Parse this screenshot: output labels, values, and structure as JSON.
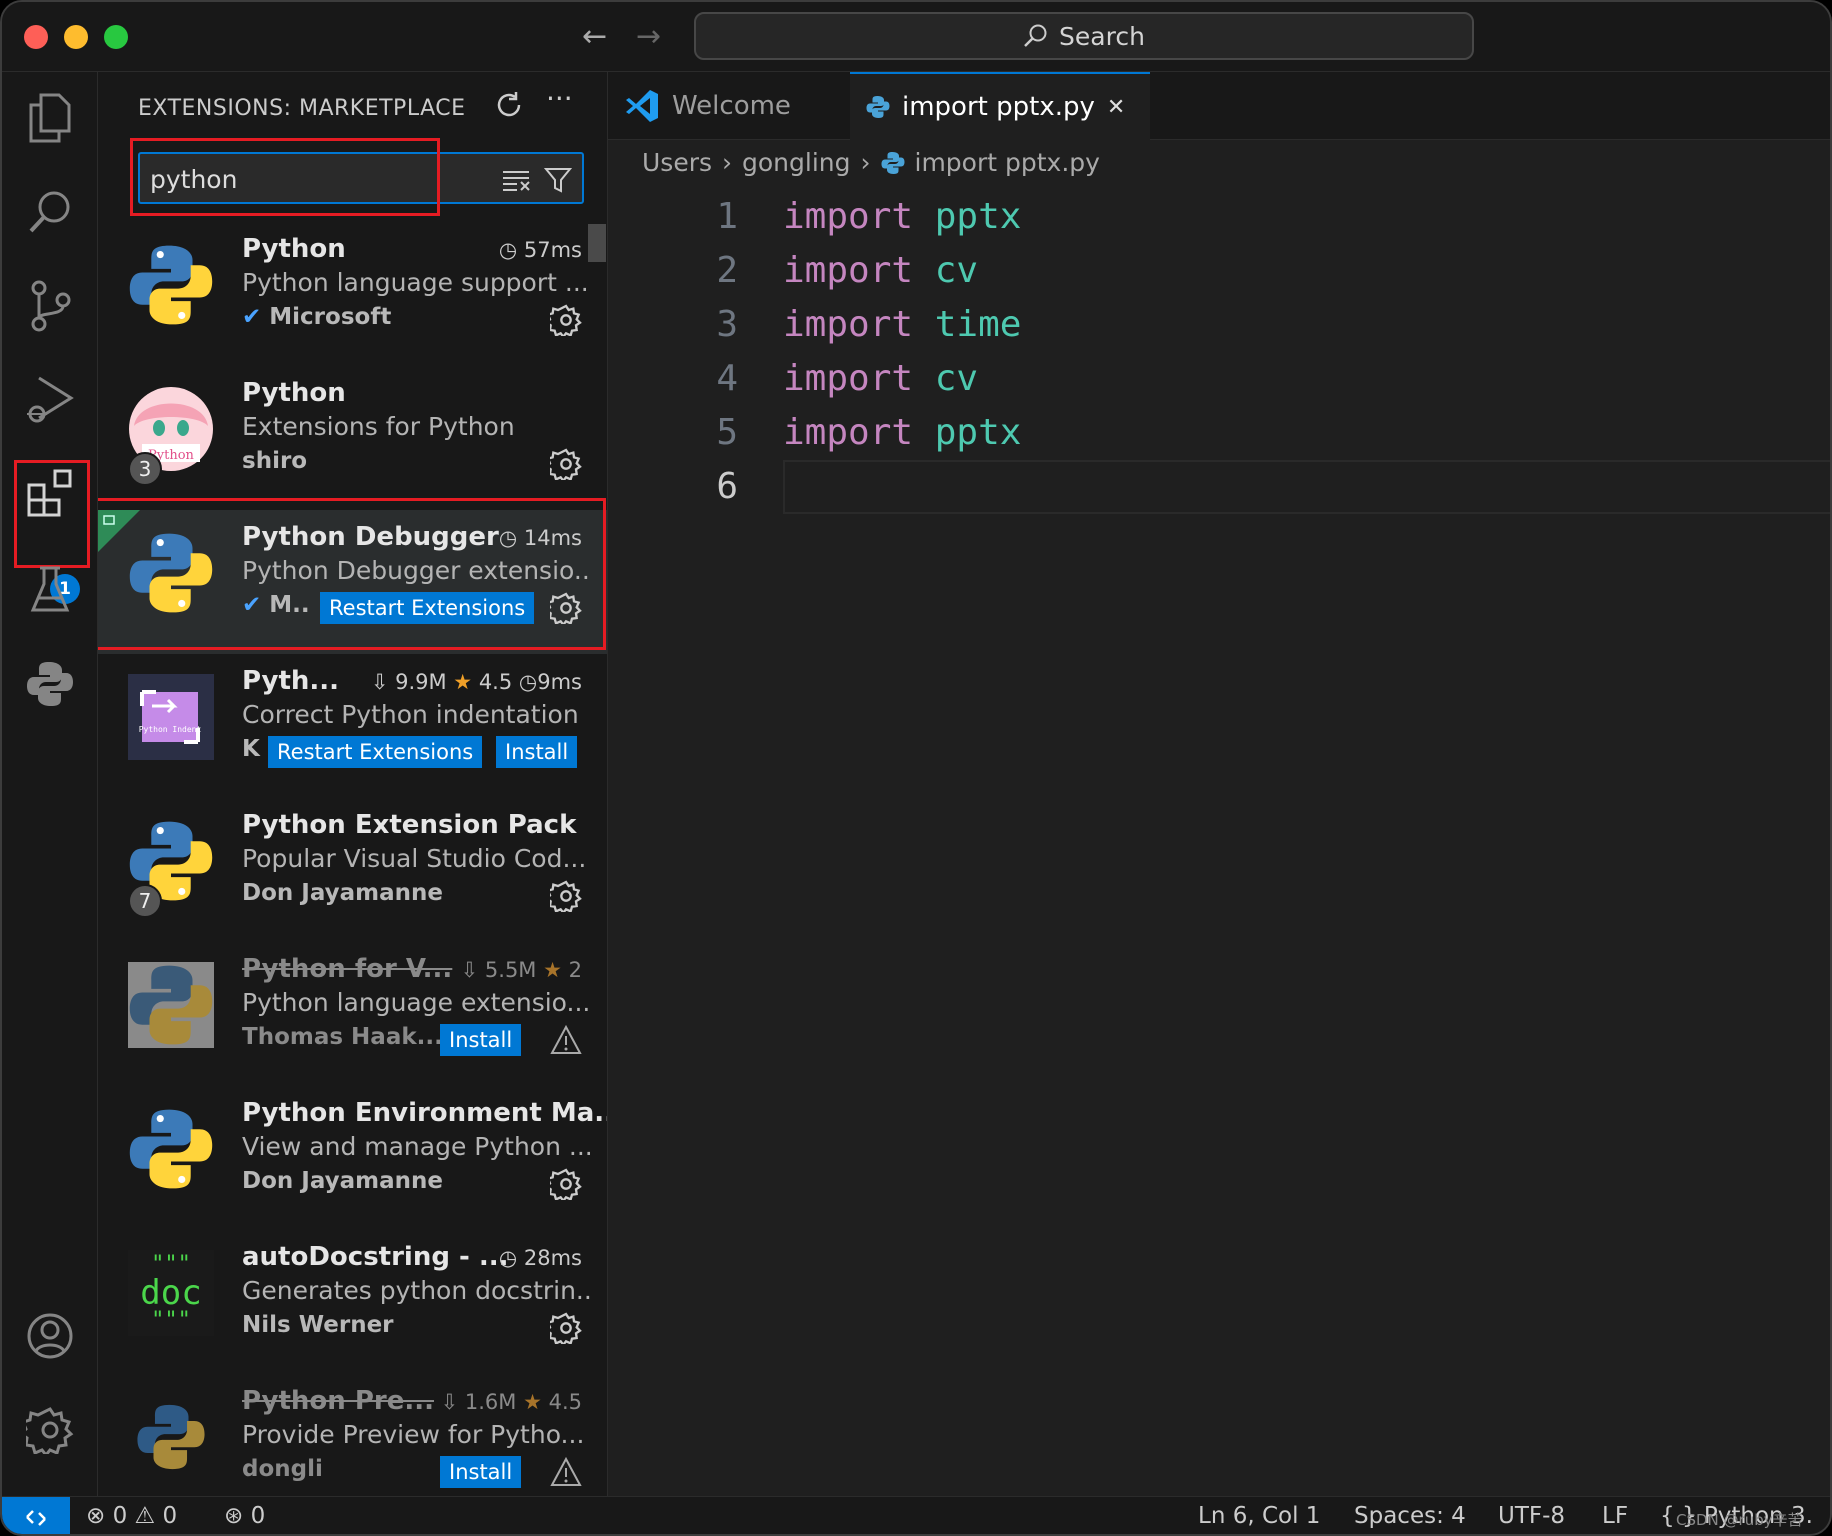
{
  "titlebar": {
    "back_arrow": "←",
    "forward_arrow": "→",
    "search_label": "Search"
  },
  "colors": {
    "accent": "#0078d4",
    "highlight_box": "#e51c23",
    "keyword": "#c586c0",
    "module": "#4ec9b0",
    "star": "#f0a028",
    "verified": "#4aa3ff"
  },
  "activity_bar": {
    "extensions_badge": "1",
    "icons": [
      "explorer-icon",
      "search-icon",
      "source-control-icon",
      "run-debug-icon",
      "extensions-icon",
      "testing-icon",
      "python-icon",
      "account-icon",
      "manage-gear-icon"
    ]
  },
  "sidebar": {
    "title": "EXTENSIONS: MARKETPLACE",
    "search_value": "python",
    "extensions": [
      {
        "name": "Python",
        "desc": "Python language support ...",
        "publisher": "Microsoft",
        "meta": "57ms"
      },
      {
        "name": "Python",
        "desc": "Extensions for Python",
        "publisher": "shiro",
        "badge": "3",
        "icon_label": "Python"
      },
      {
        "name": "Python Debugger",
        "desc": "Python Debugger extensio...",
        "publisher": "M..",
        "meta": "14ms",
        "button": "Restart Extensions"
      },
      {
        "name": "Pyth...",
        "desc": "Correct Python indentation",
        "publisher": "K",
        "downloads": "9.9M",
        "rating": "4.5",
        "meta": "9ms",
        "button": "Restart Extensions",
        "button2": "Install",
        "icon_label": "Python Indent"
      },
      {
        "name": "Python Extension Pack",
        "desc": "Popular Visual Studio Cod...",
        "publisher": "Don Jayamanne",
        "badge": "7"
      },
      {
        "name": "Python for V...",
        "desc": "Python language extensio...",
        "publisher": "Thomas Haak...",
        "downloads": "5.5M",
        "rating": "2",
        "button": "Install"
      },
      {
        "name": "Python Environment Ma...",
        "desc": "View and manage Python ...",
        "publisher": "Don Jayamanne"
      },
      {
        "name": "autoDocstring - ...",
        "desc": "Generates python docstrin...",
        "publisher": "Nils Werner",
        "meta": "28ms",
        "icon_label": "doc",
        "icon_quotes": "\"\"\""
      },
      {
        "name": "Python Pre...",
        "desc": "Provide Preview for Pytho...",
        "publisher": "dongli",
        "downloads": "1.6M",
        "rating": "4.5",
        "button": "Install"
      }
    ]
  },
  "editor": {
    "tabs": [
      {
        "label": "Welcome"
      },
      {
        "label": "import pptx.py",
        "close": "✕"
      }
    ],
    "breadcrumb": [
      "Users",
      "gongling",
      "import pptx.py"
    ],
    "breadcrumb_sep": "›",
    "lines": [
      {
        "num": "1",
        "kw": "import",
        "mod": "pptx"
      },
      {
        "num": "2",
        "kw": "import",
        "mod": "cv"
      },
      {
        "num": "3",
        "kw": "import",
        "mod": "time"
      },
      {
        "num": "4",
        "kw": "import",
        "mod": "cv"
      },
      {
        "num": "5",
        "kw": "import",
        "mod": "pptx"
      },
      {
        "num": "6",
        "kw": "",
        "mod": ""
      }
    ]
  },
  "status_bar": {
    "errors": "0",
    "warnings": "0",
    "ports": "0",
    "position": "Ln 6, Col 1",
    "spaces": "Spaces: 4",
    "encoding": "UTF-8",
    "eol": "LF",
    "language": "Python",
    "version_fragment": "3.",
    "watermark": "CSDN @ruby辛苦"
  }
}
